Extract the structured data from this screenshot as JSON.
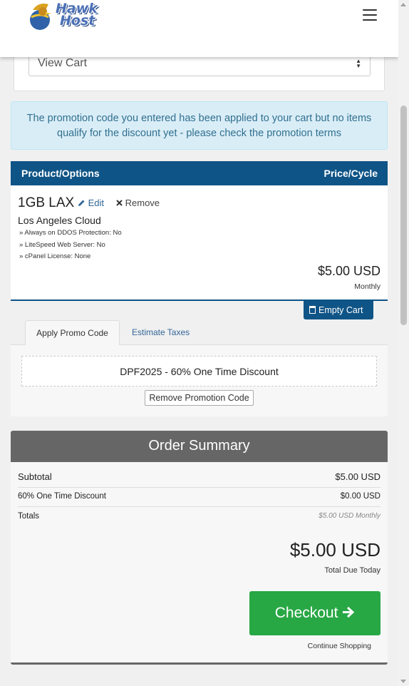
{
  "header": {
    "logo_line1": "Hawk",
    "logo_line2": "Host",
    "menu_icon": "hamburger-menu-icon"
  },
  "view_cart": {
    "selected": "View Cart"
  },
  "alert": {
    "text": "The promotion code you entered has been applied to your cart but no items qualify for the discount yet - please check the promotion terms"
  },
  "cart": {
    "col_product": "Product/Options",
    "col_price": "Price/Cycle",
    "product": {
      "name": "1GB LAX",
      "edit_label": "Edit",
      "remove_label": "Remove",
      "group": "Los Angeles Cloud",
      "options": [
        "» Always on DDOS Protection: No",
        "» LiteSpeed Web Server: No",
        "» cPanel License: None"
      ],
      "price": "$5.00 USD",
      "cycle": "Monthly"
    },
    "empty_cart_label": "Empty Cart"
  },
  "tabs": {
    "promo": "Apply Promo Code",
    "taxes": "Estimate Taxes"
  },
  "promo": {
    "applied_code": "DPF2025 - 60% One Time Discount",
    "remove_label": "Remove Promotion Code"
  },
  "summary": {
    "title": "Order Summary",
    "subtotal_label": "Subtotal",
    "subtotal_value": "$5.00 USD",
    "discount_label": "60% One Time Discount",
    "discount_value": "$0.00 USD",
    "totals_label": "Totals",
    "totals_value": "$5.00 USD Monthly",
    "total_due": "$5.00 USD",
    "total_due_label": "Total Due Today",
    "checkout_label": "Checkout",
    "continue_label": "Continue Shopping"
  },
  "colors": {
    "primary": "#0f5486",
    "success": "#28a745",
    "alert_bg": "#d9edf7",
    "alert_text": "#31708f",
    "summary_header": "#666666"
  }
}
